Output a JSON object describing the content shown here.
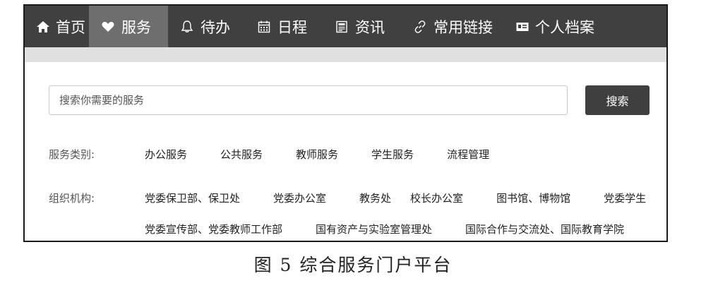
{
  "nav": {
    "items": [
      {
        "label": "首页",
        "icon": "home-icon"
      },
      {
        "label": "服务",
        "icon": "heart-icon"
      },
      {
        "label": "待办",
        "icon": "bell-icon"
      },
      {
        "label": "日程",
        "icon": "calendar-icon"
      },
      {
        "label": "资讯",
        "icon": "news-icon"
      },
      {
        "label": "常用链接",
        "icon": "link-icon"
      },
      {
        "label": "个人档案",
        "icon": "id-card-icon"
      }
    ],
    "active_item": "服务"
  },
  "search": {
    "placeholder": "搜索你需要的服务",
    "button_label": "搜索"
  },
  "service_categories": {
    "label": "服务类别:",
    "items": [
      "办公服务",
      "公共服务",
      "教师服务",
      "学生服务",
      "流程管理"
    ]
  },
  "organizations": {
    "label": "组织机构:",
    "row1": [
      "党委保卫部、保卫处",
      "党委办公室",
      "教务处",
      "校长办公室",
      "图书馆、博物馆",
      "党委学生"
    ],
    "row2": [
      "党委宣传部、党委教师工作部",
      "国有资产与实验室管理处",
      "国际合作与交流处、国际教育学院"
    ]
  },
  "caption": "图 5   综合服务门户平台",
  "colors": {
    "navbar": "#404040",
    "nav_active": "#6e6e6e",
    "button": "#3f3f3f"
  }
}
